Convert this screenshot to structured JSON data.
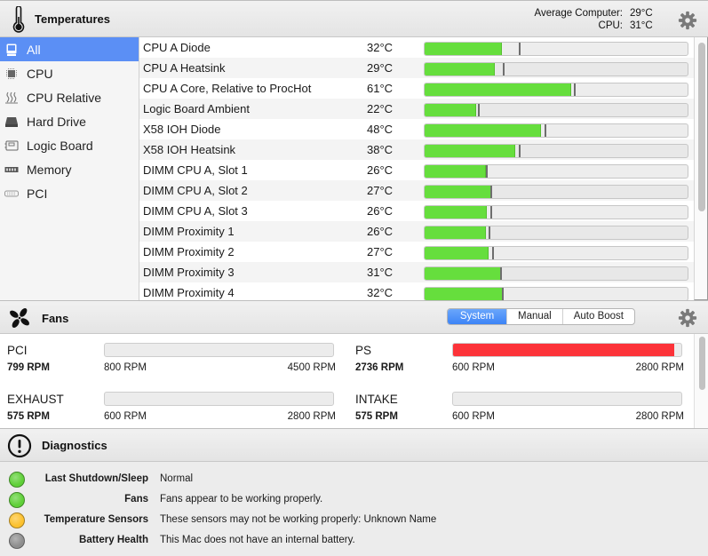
{
  "temperatures": {
    "title": "Temperatures",
    "icon": "thermometer-icon",
    "summary": [
      {
        "label": "Average Computer:",
        "value": "29°C"
      },
      {
        "label": "CPU:",
        "value": "31°C"
      }
    ],
    "sidebar": [
      {
        "label": "All",
        "icon": "computer-icon",
        "active": true
      },
      {
        "label": "CPU",
        "icon": "chip-icon",
        "active": false
      },
      {
        "label": "CPU Relative",
        "icon": "heat-waves-icon",
        "active": false
      },
      {
        "label": "Hard Drive",
        "icon": "hard-drive-icon",
        "active": false
      },
      {
        "label": "Logic Board",
        "icon": "logic-board-icon",
        "active": false
      },
      {
        "label": "Memory",
        "icon": "memory-icon",
        "active": false
      },
      {
        "label": "PCI",
        "icon": "pci-card-icon",
        "active": false
      }
    ],
    "sensors": [
      {
        "name": "CPU A Diode",
        "temp": "32°C",
        "fill_pct": 29.3,
        "max_pct": 36.0
      },
      {
        "name": "CPU A Heatsink",
        "temp": "29°C",
        "fill_pct": 26.6,
        "max_pct": 30.0
      },
      {
        "name": "CPU A Core, Relative to ProcHot",
        "temp": "61°C",
        "fill_pct": 55.9,
        "max_pct": 57.2
      },
      {
        "name": "Logic Board Ambient",
        "temp": "22°C",
        "fill_pct": 19.5,
        "max_pct": 20.5
      },
      {
        "name": "X58 IOH Diode",
        "temp": "48°C",
        "fill_pct": 44.1,
        "max_pct": 46.1
      },
      {
        "name": "X58 IOH Heatsink",
        "temp": "38°C",
        "fill_pct": 34.3,
        "max_pct": 36.0
      },
      {
        "name": "DIMM CPU A, Slot 1",
        "temp": "26°C",
        "fill_pct": 23.2,
        "max_pct": 23.6
      },
      {
        "name": "DIMM CPU A, Slot 2",
        "temp": "27°C",
        "fill_pct": 25.3,
        "max_pct": 25.3
      },
      {
        "name": "DIMM CPU A, Slot 3",
        "temp": "26°C",
        "fill_pct": 23.6,
        "max_pct": 25.3
      },
      {
        "name": "DIMM Proximity 1",
        "temp": "26°C",
        "fill_pct": 23.2,
        "max_pct": 24.6
      },
      {
        "name": "DIMM Proximity 2",
        "temp": "27°C",
        "fill_pct": 24.2,
        "max_pct": 25.9
      },
      {
        "name": "DIMM Proximity 3",
        "temp": "31°C",
        "fill_pct": 29.0,
        "max_pct": 29.0
      },
      {
        "name": "DIMM Proximity 4",
        "temp": "32°C",
        "fill_pct": 29.6,
        "max_pct": 29.6
      }
    ],
    "colors": {
      "bar_fill": "#66de3d",
      "selected": "#5b8ff5"
    }
  },
  "fans": {
    "title": "Fans",
    "icon": "fan-icon",
    "modes": [
      {
        "label": "System",
        "active": true
      },
      {
        "label": "Manual",
        "active": false
      },
      {
        "label": "Auto Boost",
        "active": false
      }
    ],
    "items": [
      {
        "name": "PCI",
        "rpm": "799 RPM",
        "min": "800 RPM",
        "max": "4500 RPM",
        "fill_pct": 0
      },
      {
        "name": "PS",
        "rpm": "2736 RPM",
        "min": "600 RPM",
        "max": "2800 RPM",
        "fill_pct": 97
      },
      {
        "name": "EXHAUST",
        "rpm": "575 RPM",
        "min": "600 RPM",
        "max": "2800 RPM",
        "fill_pct": 0
      },
      {
        "name": "INTAKE",
        "rpm": "575 RPM",
        "min": "600 RPM",
        "max": "2800 RPM",
        "fill_pct": 0
      }
    ],
    "colors": {
      "bar_fill": "#fc3339"
    }
  },
  "diagnostics": {
    "title": "Diagnostics",
    "icon": "alert-circle-icon",
    "items": [
      {
        "label": "Last Shutdown/Sleep",
        "value": "Normal",
        "status": "ok",
        "color": "#5fd038"
      },
      {
        "label": "Fans",
        "value": "Fans appear to be working properly.",
        "status": "ok",
        "color": "#5fd038"
      },
      {
        "label": "Temperature Sensors",
        "value": "These sensors may not be working properly: Unknown Name",
        "status": "warning",
        "color": "#fcc12e"
      },
      {
        "label": "Battery Health",
        "value": "This Mac does not have an internal battery.",
        "status": "none",
        "color": "#8e8e8e"
      }
    ]
  }
}
